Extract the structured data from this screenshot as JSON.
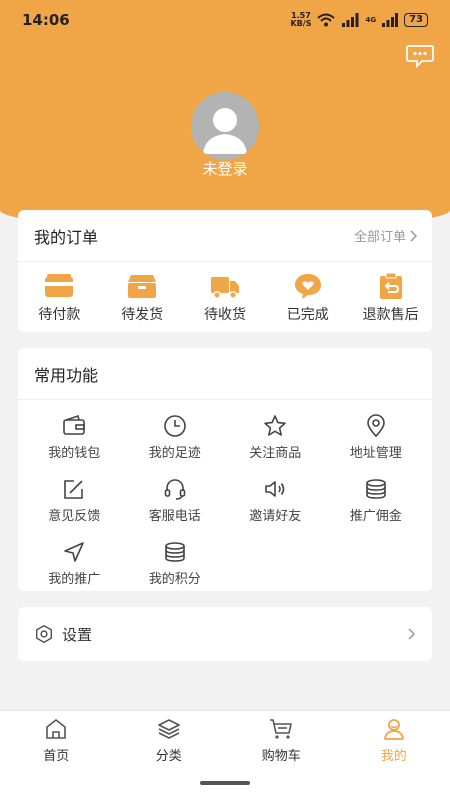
{
  "status": {
    "time": "14:06",
    "net_speed_top": "1.57",
    "net_speed_bottom": "KB/S",
    "network_type": "4G",
    "battery": "73"
  },
  "profile": {
    "login_label": "未登录"
  },
  "orders": {
    "title": "我的订单",
    "all_link": "全部订单",
    "items": [
      {
        "label": "待付款",
        "icon": "wallet-icon"
      },
      {
        "label": "待发货",
        "icon": "package-icon"
      },
      {
        "label": "待收货",
        "icon": "truck-icon"
      },
      {
        "label": "已完成",
        "icon": "heart-bubble-icon"
      },
      {
        "label": "退款售后",
        "icon": "refund-icon"
      }
    ]
  },
  "functions": {
    "title": "常用功能",
    "items": [
      {
        "label": "我的钱包",
        "icon": "wallet-icon"
      },
      {
        "label": "我的足迹",
        "icon": "clock-icon"
      },
      {
        "label": "关注商品",
        "icon": "star-icon"
      },
      {
        "label": "地址管理",
        "icon": "location-pin-icon"
      },
      {
        "label": "意见反馈",
        "icon": "edit-icon"
      },
      {
        "label": "客服电话",
        "icon": "headset-icon"
      },
      {
        "label": "邀请好友",
        "icon": "speaker-icon"
      },
      {
        "label": "推广佣金",
        "icon": "coins-icon"
      },
      {
        "label": "我的推广",
        "icon": "navigation-icon"
      },
      {
        "label": "我的积分",
        "icon": "coins-icon"
      }
    ]
  },
  "settings": {
    "label": "设置"
  },
  "tabs": [
    {
      "label": "首页",
      "icon": "home-icon"
    },
    {
      "label": "分类",
      "icon": "layers-icon"
    },
    {
      "label": "购物车",
      "icon": "cart-icon"
    },
    {
      "label": "我的",
      "icon": "user-icon"
    }
  ],
  "colors": {
    "accent": "#f0a547",
    "background": "#f2f2f2",
    "card": "#ffffff"
  }
}
